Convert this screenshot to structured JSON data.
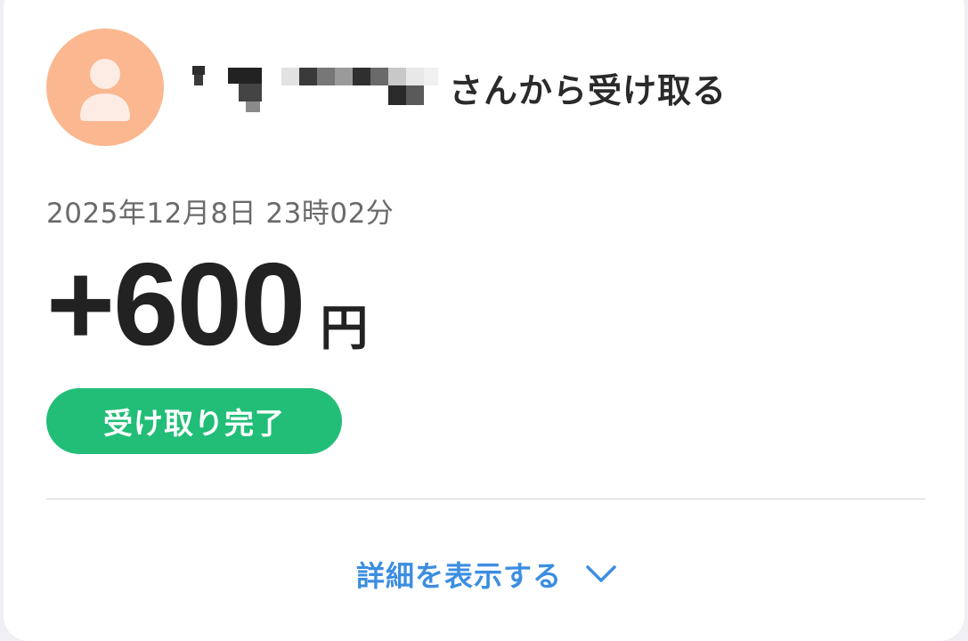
{
  "transaction": {
    "avatar_icon": "person-icon",
    "sender_suffix": "さんから受け取る",
    "timestamp": "2025年12月8日 23時02分",
    "amount": "+600",
    "currency_unit": "円",
    "status": "受け取り完了",
    "details_label": "詳細を表示する",
    "details_icon": "chevron-down-icon"
  },
  "colors": {
    "avatar_bg": "#fbb78f",
    "avatar_figure": "#fdece3",
    "status_green": "#22be78",
    "link_blue": "#3c8ee0",
    "amount_text": "#222222"
  }
}
